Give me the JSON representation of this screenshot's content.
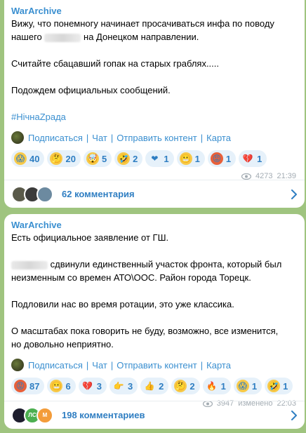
{
  "posts": [
    {
      "channel": "WarArchive",
      "line1": "Вижу, что понемногу начинает просачиваться инфа по поводу",
      "line2a": "нашего",
      "line2b": "на Донецком направлении.",
      "line3": "Считайте сбацавший гопак на старых граблях.....",
      "line4": "Подождем официальных сообщений.",
      "hashtag": "#НічнаZрада",
      "links": [
        "Подписаться",
        "Чат",
        "Отправить контент",
        "Карта"
      ],
      "reactions": [
        {
          "icon": "scream-emoji",
          "glyph": "😱",
          "count": "40",
          "bg": "#f7c948"
        },
        {
          "icon": "thinking-emoji",
          "glyph": "🤔",
          "count": "20",
          "bg": "#f7c948"
        },
        {
          "icon": "exploding-head-emoji",
          "glyph": "🤯",
          "count": "5",
          "bg": "#f7c948"
        },
        {
          "icon": "rofl-emoji",
          "glyph": "🤣",
          "count": "2",
          "bg": "#f7c948"
        },
        {
          "icon": "red-heart-emoji",
          "glyph": "❤",
          "count": "1",
          "bg": "transparent"
        },
        {
          "icon": "grimace-emoji",
          "glyph": "😬",
          "count": "1",
          "bg": "#f7c948"
        },
        {
          "icon": "angry-emoji",
          "glyph": "😡",
          "count": "1",
          "bg": "#e8603a"
        },
        {
          "icon": "broken-heart-emoji",
          "glyph": "💔",
          "count": "1",
          "bg": "transparent"
        }
      ],
      "views": "4273",
      "time": "21:39",
      "edited": "",
      "comments": "62 комментария"
    },
    {
      "channel": "WarArchive",
      "line1": "Есть официальное заявление от ГШ.",
      "line2b": "сдвинули единственный участок фронта, который был",
      "line2c": "неизменным со времен АТО\\ООС. Район города Торецк.",
      "line3": "Подловили нас во время ротации, это уже классика.",
      "line4a": "О масштабах пока говорить не буду, возможно, все изменится,",
      "line4b": "но довольно неприятно.",
      "links": [
        "Подписаться",
        "Чат",
        "Отправить контент",
        "Карта"
      ],
      "reactions": [
        {
          "icon": "angry-emoji",
          "glyph": "😡",
          "count": "87",
          "bg": "#e8603a"
        },
        {
          "icon": "grimace-emoji",
          "glyph": "😬",
          "count": "6",
          "bg": "#f7c948"
        },
        {
          "icon": "broken-heart-emoji",
          "glyph": "💔",
          "count": "3",
          "bg": "transparent"
        },
        {
          "icon": "pointing-hand-emoji",
          "glyph": "👉",
          "count": "3",
          "bg": "transparent"
        },
        {
          "icon": "thumbs-up-emoji",
          "glyph": "👍",
          "count": "2",
          "bg": "transparent"
        },
        {
          "icon": "thinking-emoji",
          "glyph": "🤔",
          "count": "2",
          "bg": "#f7c948"
        },
        {
          "icon": "fire-emoji",
          "glyph": "🔥",
          "count": "1",
          "bg": "transparent"
        },
        {
          "icon": "scream-emoji",
          "glyph": "😱",
          "count": "1",
          "bg": "#f7c948"
        },
        {
          "icon": "rofl-emoji",
          "glyph": "🤣",
          "count": "1",
          "bg": "#f7c948"
        }
      ],
      "views": "3947",
      "time": "22:03",
      "edited": "изменено",
      "comments": "198 комментариев",
      "avatar_letters": [
        "ЛС",
        "М"
      ]
    }
  ],
  "colors": {
    "accent": "#3a8fd0",
    "background": "#9fc47f",
    "pill": "#e6f1fa",
    "meta": "#a3acb3"
  }
}
